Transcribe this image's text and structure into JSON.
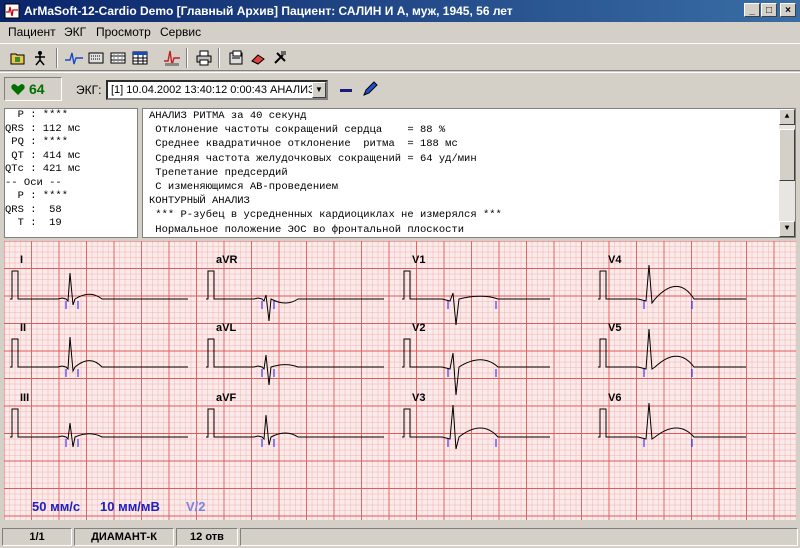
{
  "window": {
    "title": "ArMaSoft-12-Cardio Demo [Главный Архив]  Пациент: САЛИН И А,  муж,  1945,  56 лет",
    "buttons": [
      "minimize-icon",
      "maximize-icon",
      "close-icon"
    ]
  },
  "menu": [
    "Пациент",
    "ЭКГ",
    "Просмотр",
    "Сервис"
  ],
  "toolbar": [
    "open-folder-icon",
    "stickman-icon",
    "ecg-wave-icon",
    "keyboard-icon",
    "film-icon",
    "table-icon",
    "chart-icon",
    "printer-icon",
    "archive-icon",
    "eraser-icon",
    "tools-icon"
  ],
  "ekgbar": {
    "heart_rate": "64",
    "label": "ЭКГ:",
    "selected": "[1] 10.04.2002 13:40:12  0:00:43 АНАЛИЗ"
  },
  "params": [
    "  P : ****",
    "QRS : 112 мс",
    " PQ : ****",
    " QT : 414 мс",
    "QTc : 421 мс",
    "-- Оси --",
    "  P : ****",
    "QRS :  58",
    "  T :  19"
  ],
  "report": [
    "АНАЛИЗ РИТМА за 40 секунд",
    " Отклонение частоты сокращений сердца    = 88 %",
    " Среднее квадратичное отклонение  ритма  = 188 мс",
    " Средняя частота желудочковых сокращений = 64 уд/мин",
    " Трепетание предсердий",
    " С изменяющимся АВ-проведением",
    "КОНТУРНЫЙ АНАЛИЗ",
    " *** Р-зубец в усредненных кардиоциклах не измерялся ***",
    " Нормальное положение ЭОС во фронтальной плоскости"
  ],
  "leads": [
    "I",
    "II",
    "III",
    "aVR",
    "aVL",
    "aVF",
    "V1",
    "V2",
    "V3",
    "V4",
    "V5",
    "V6"
  ],
  "ecg_footer": {
    "speed": "50 мм/с",
    "gain": "10 мм/мВ",
    "filter": "V/2"
  },
  "colors": {
    "grid_minor": "#f2b4b4",
    "grid_major": "#e05a5a",
    "ecg_bg": "#fbeaea",
    "trace": "#000000",
    "marker_pre": "#1a1aff",
    "footer_text": "#2020c0"
  },
  "status": [
    "1/1",
    "ДИАМАНТ-К",
    "12 отв"
  ]
}
